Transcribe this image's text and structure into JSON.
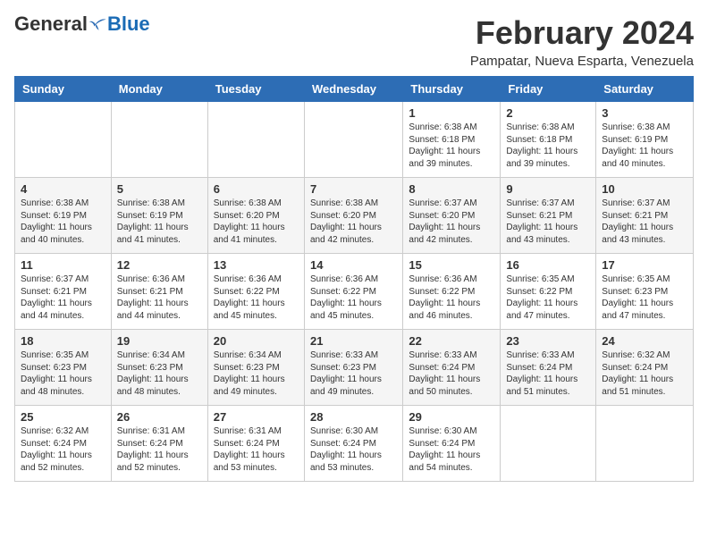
{
  "header": {
    "logo_general": "General",
    "logo_blue": "Blue",
    "title": "February 2024",
    "subtitle": "Pampatar, Nueva Esparta, Venezuela"
  },
  "days_of_week": [
    "Sunday",
    "Monday",
    "Tuesday",
    "Wednesday",
    "Thursday",
    "Friday",
    "Saturday"
  ],
  "weeks": [
    [
      {
        "day": "",
        "info": ""
      },
      {
        "day": "",
        "info": ""
      },
      {
        "day": "",
        "info": ""
      },
      {
        "day": "",
        "info": ""
      },
      {
        "day": "1",
        "info": "Sunrise: 6:38 AM\nSunset: 6:18 PM\nDaylight: 11 hours and 39 minutes."
      },
      {
        "day": "2",
        "info": "Sunrise: 6:38 AM\nSunset: 6:18 PM\nDaylight: 11 hours and 39 minutes."
      },
      {
        "day": "3",
        "info": "Sunrise: 6:38 AM\nSunset: 6:19 PM\nDaylight: 11 hours and 40 minutes."
      }
    ],
    [
      {
        "day": "4",
        "info": "Sunrise: 6:38 AM\nSunset: 6:19 PM\nDaylight: 11 hours and 40 minutes."
      },
      {
        "day": "5",
        "info": "Sunrise: 6:38 AM\nSunset: 6:19 PM\nDaylight: 11 hours and 41 minutes."
      },
      {
        "day": "6",
        "info": "Sunrise: 6:38 AM\nSunset: 6:20 PM\nDaylight: 11 hours and 41 minutes."
      },
      {
        "day": "7",
        "info": "Sunrise: 6:38 AM\nSunset: 6:20 PM\nDaylight: 11 hours and 42 minutes."
      },
      {
        "day": "8",
        "info": "Sunrise: 6:37 AM\nSunset: 6:20 PM\nDaylight: 11 hours and 42 minutes."
      },
      {
        "day": "9",
        "info": "Sunrise: 6:37 AM\nSunset: 6:21 PM\nDaylight: 11 hours and 43 minutes."
      },
      {
        "day": "10",
        "info": "Sunrise: 6:37 AM\nSunset: 6:21 PM\nDaylight: 11 hours and 43 minutes."
      }
    ],
    [
      {
        "day": "11",
        "info": "Sunrise: 6:37 AM\nSunset: 6:21 PM\nDaylight: 11 hours and 44 minutes."
      },
      {
        "day": "12",
        "info": "Sunrise: 6:36 AM\nSunset: 6:21 PM\nDaylight: 11 hours and 44 minutes."
      },
      {
        "day": "13",
        "info": "Sunrise: 6:36 AM\nSunset: 6:22 PM\nDaylight: 11 hours and 45 minutes."
      },
      {
        "day": "14",
        "info": "Sunrise: 6:36 AM\nSunset: 6:22 PM\nDaylight: 11 hours and 45 minutes."
      },
      {
        "day": "15",
        "info": "Sunrise: 6:36 AM\nSunset: 6:22 PM\nDaylight: 11 hours and 46 minutes."
      },
      {
        "day": "16",
        "info": "Sunrise: 6:35 AM\nSunset: 6:22 PM\nDaylight: 11 hours and 47 minutes."
      },
      {
        "day": "17",
        "info": "Sunrise: 6:35 AM\nSunset: 6:23 PM\nDaylight: 11 hours and 47 minutes."
      }
    ],
    [
      {
        "day": "18",
        "info": "Sunrise: 6:35 AM\nSunset: 6:23 PM\nDaylight: 11 hours and 48 minutes."
      },
      {
        "day": "19",
        "info": "Sunrise: 6:34 AM\nSunset: 6:23 PM\nDaylight: 11 hours and 48 minutes."
      },
      {
        "day": "20",
        "info": "Sunrise: 6:34 AM\nSunset: 6:23 PM\nDaylight: 11 hours and 49 minutes."
      },
      {
        "day": "21",
        "info": "Sunrise: 6:33 AM\nSunset: 6:23 PM\nDaylight: 11 hours and 49 minutes."
      },
      {
        "day": "22",
        "info": "Sunrise: 6:33 AM\nSunset: 6:24 PM\nDaylight: 11 hours and 50 minutes."
      },
      {
        "day": "23",
        "info": "Sunrise: 6:33 AM\nSunset: 6:24 PM\nDaylight: 11 hours and 51 minutes."
      },
      {
        "day": "24",
        "info": "Sunrise: 6:32 AM\nSunset: 6:24 PM\nDaylight: 11 hours and 51 minutes."
      }
    ],
    [
      {
        "day": "25",
        "info": "Sunrise: 6:32 AM\nSunset: 6:24 PM\nDaylight: 11 hours and 52 minutes."
      },
      {
        "day": "26",
        "info": "Sunrise: 6:31 AM\nSunset: 6:24 PM\nDaylight: 11 hours and 52 minutes."
      },
      {
        "day": "27",
        "info": "Sunrise: 6:31 AM\nSunset: 6:24 PM\nDaylight: 11 hours and 53 minutes."
      },
      {
        "day": "28",
        "info": "Sunrise: 6:30 AM\nSunset: 6:24 PM\nDaylight: 11 hours and 53 minutes."
      },
      {
        "day": "29",
        "info": "Sunrise: 6:30 AM\nSunset: 6:24 PM\nDaylight: 11 hours and 54 minutes."
      },
      {
        "day": "",
        "info": ""
      },
      {
        "day": "",
        "info": ""
      }
    ]
  ]
}
